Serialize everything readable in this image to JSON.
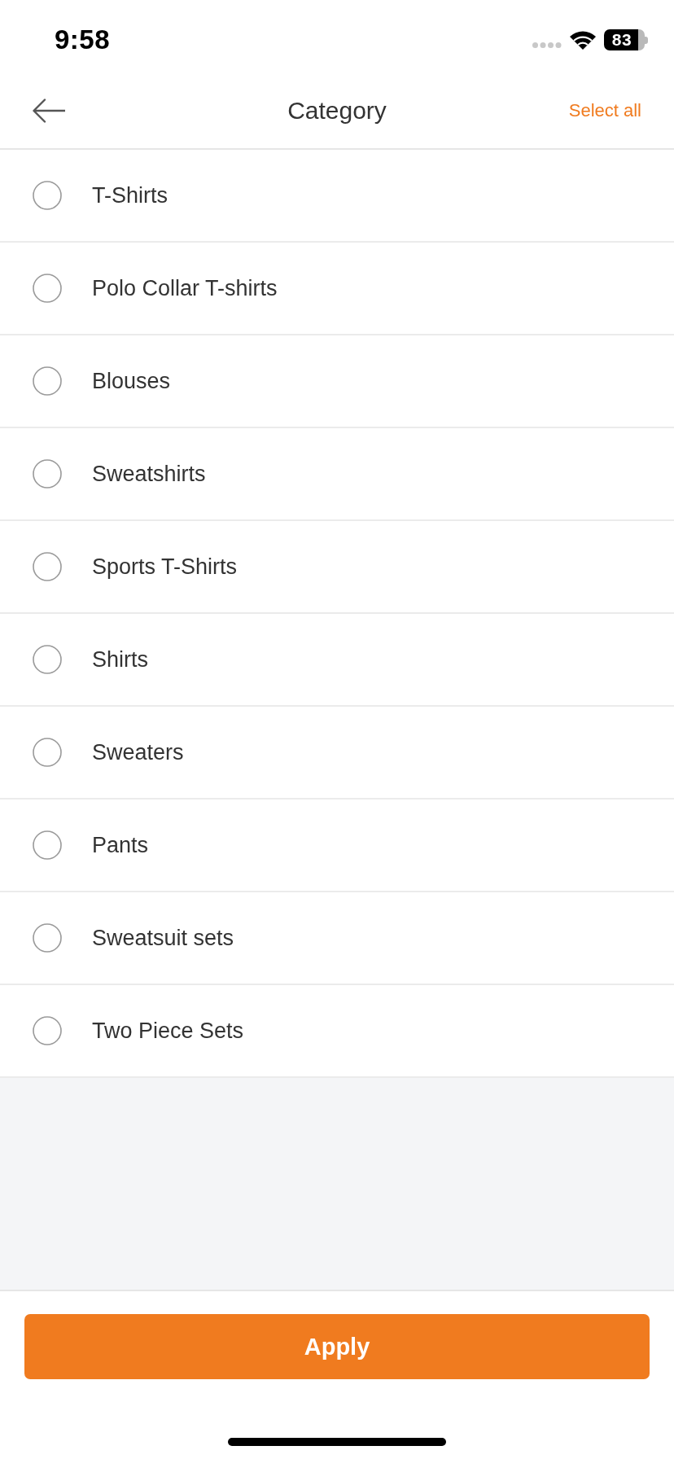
{
  "status_bar": {
    "time": "9:58",
    "battery": "83"
  },
  "header": {
    "title": "Category",
    "action": "Select all"
  },
  "categories": [
    {
      "label": "T-Shirts",
      "selected": false
    },
    {
      "label": "Polo Collar T-shirts",
      "selected": false
    },
    {
      "label": "Blouses",
      "selected": false
    },
    {
      "label": "Sweatshirts",
      "selected": false
    },
    {
      "label": "Sports T-Shirts",
      "selected": false
    },
    {
      "label": "Shirts",
      "selected": false
    },
    {
      "label": "Sweaters",
      "selected": false
    },
    {
      "label": "Pants",
      "selected": false
    },
    {
      "label": "Sweatsuit sets",
      "selected": false
    },
    {
      "label": "Two Piece Sets",
      "selected": false
    }
  ],
  "apply_button": {
    "label": "Apply"
  }
}
